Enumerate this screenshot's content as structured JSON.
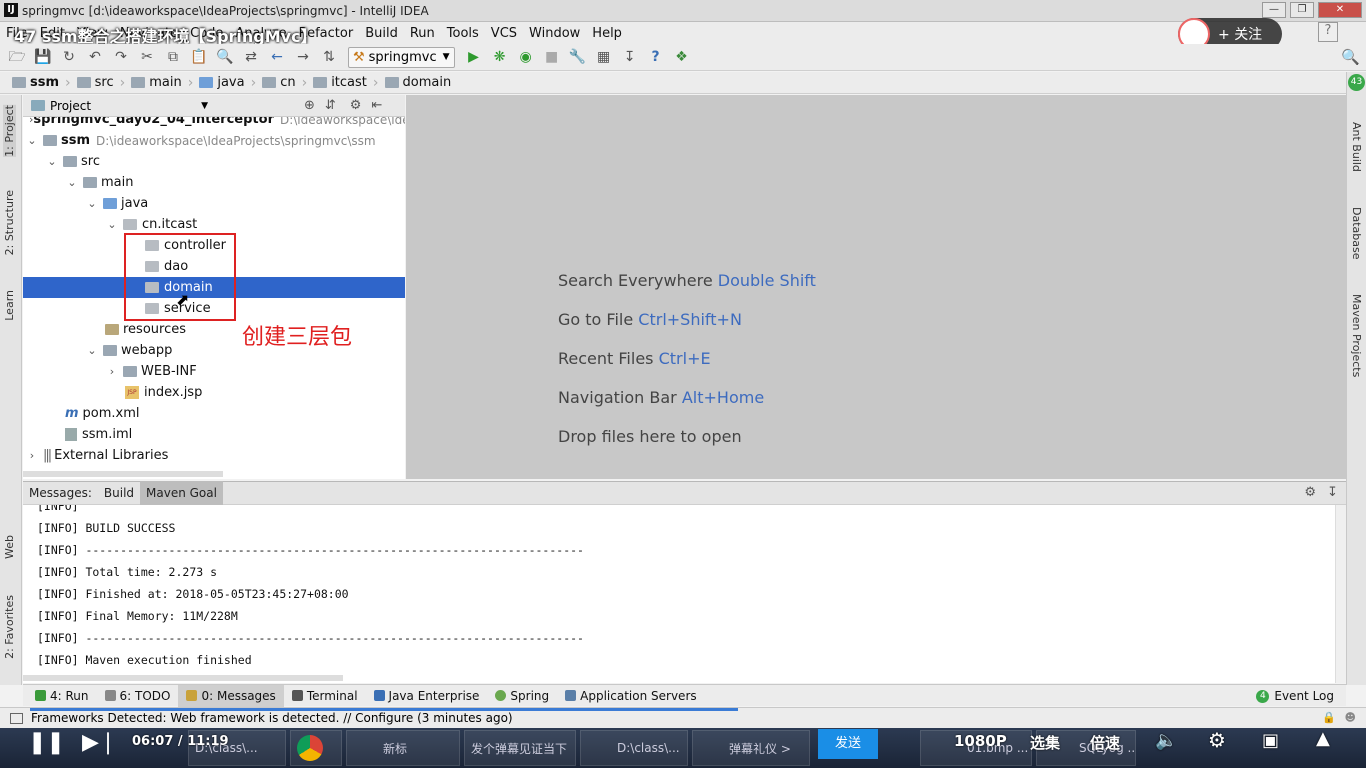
{
  "window": {
    "title": "springmvc [d:\\ideaworkspace\\IdeaProjects\\springmvc] - IntelliJ IDEA",
    "app_icon": "IJ"
  },
  "video": {
    "title": "47 ssm整合之搭建环境【SpringMvc】",
    "follow_label": "关注",
    "time_current": "06:07",
    "time_total": "11:19",
    "time_sep": "/",
    "send_label": "发送",
    "quality_label": "1080P",
    "episodes_label": "选集",
    "speed_label": "倍速"
  },
  "menu": [
    "File",
    "Edit",
    "View",
    "Navigate",
    "Code",
    "Analyze",
    "Refactor",
    "Build",
    "Run",
    "Tools",
    "VCS",
    "Window",
    "Help"
  ],
  "toolbar": {
    "run_config": "springmvc"
  },
  "breadcrumb": [
    "ssm",
    "src",
    "main",
    "java",
    "cn",
    "itcast",
    "domain"
  ],
  "left_tabs": [
    "1: Project",
    "2: Structure",
    "Learn",
    "Web",
    "2: Favorites"
  ],
  "right_tabs": [
    "Ant Build",
    "Database",
    "Maven Projects"
  ],
  "right_badge": "43",
  "project": {
    "header": "Project",
    "tree": [
      {
        "label": "springmvc_day02_04_interceptor",
        "path": "D:\\ideaworkspace\\idea"
      },
      {
        "label": "ssm",
        "path": "D:\\ideaworkspace\\IdeaProjects\\springmvc\\ssm"
      },
      {
        "label": "src"
      },
      {
        "label": "main"
      },
      {
        "label": "java"
      },
      {
        "label": "cn.itcast"
      },
      {
        "label": "controller"
      },
      {
        "label": "dao"
      },
      {
        "label": "domain"
      },
      {
        "label": "service"
      },
      {
        "label": "resources"
      },
      {
        "label": "webapp"
      },
      {
        "label": "WEB-INF"
      },
      {
        "label": "index.jsp"
      },
      {
        "label": "pom.xml"
      },
      {
        "label": "ssm.iml"
      },
      {
        "label": "External Libraries"
      }
    ]
  },
  "annotation": "创建三层包",
  "editor_hints": [
    {
      "text": "Search Everywhere",
      "key": "Double Shift"
    },
    {
      "text": "Go to File",
      "key": "Ctrl+Shift+N"
    },
    {
      "text": "Recent Files",
      "key": "Ctrl+E"
    },
    {
      "text": "Navigation Bar",
      "key": "Alt+Home"
    },
    {
      "text": "Drop files here to open",
      "key": ""
    }
  ],
  "messages": {
    "label": "Messages:",
    "tabs": [
      "Build",
      "Maven Goal"
    ],
    "lines": [
      "[INFO]",
      "[INFO] BUILD SUCCESS",
      "[INFO] ------------------------------------------------------------------------",
      "[INFO] Total time: 2.273 s",
      "[INFO] Finished at: 2018-05-05T23:45:27+08:00",
      "[INFO] Final Memory: 11M/228M",
      "[INFO] ------------------------------------------------------------------------",
      "[INFO] Maven execution finished"
    ]
  },
  "tool_tabs": [
    {
      "label": "4: Run",
      "icon": "run-icon",
      "color": "#3a9a3a"
    },
    {
      "label": "6: TODO",
      "icon": "todo-icon",
      "color": "#888888"
    },
    {
      "label": "0: Messages",
      "icon": "messages-icon",
      "color": "#c9a23a"
    },
    {
      "label": "Terminal",
      "icon": "terminal-icon",
      "color": "#555555"
    },
    {
      "label": "Java Enterprise",
      "icon": "java-enterprise-icon",
      "color": "#3a6fb5"
    },
    {
      "label": "Spring",
      "icon": "spring-icon",
      "color": "#6aa84f"
    },
    {
      "label": "Application Servers",
      "icon": "app-servers-icon",
      "color": "#5a7fa8"
    }
  ],
  "event_log": {
    "count": "4",
    "label": "Event Log"
  },
  "status": "Frameworks Detected: Web framework is detected. // Configure (3 minutes ago)",
  "taskbar": [
    "D:\\class\\...",
    "新标",
    "发个弹幕见证当下",
    "D:\\class\\...",
    "弹幕礼仪 >",
    "01.bmp ...",
    "SQLyog ..."
  ]
}
